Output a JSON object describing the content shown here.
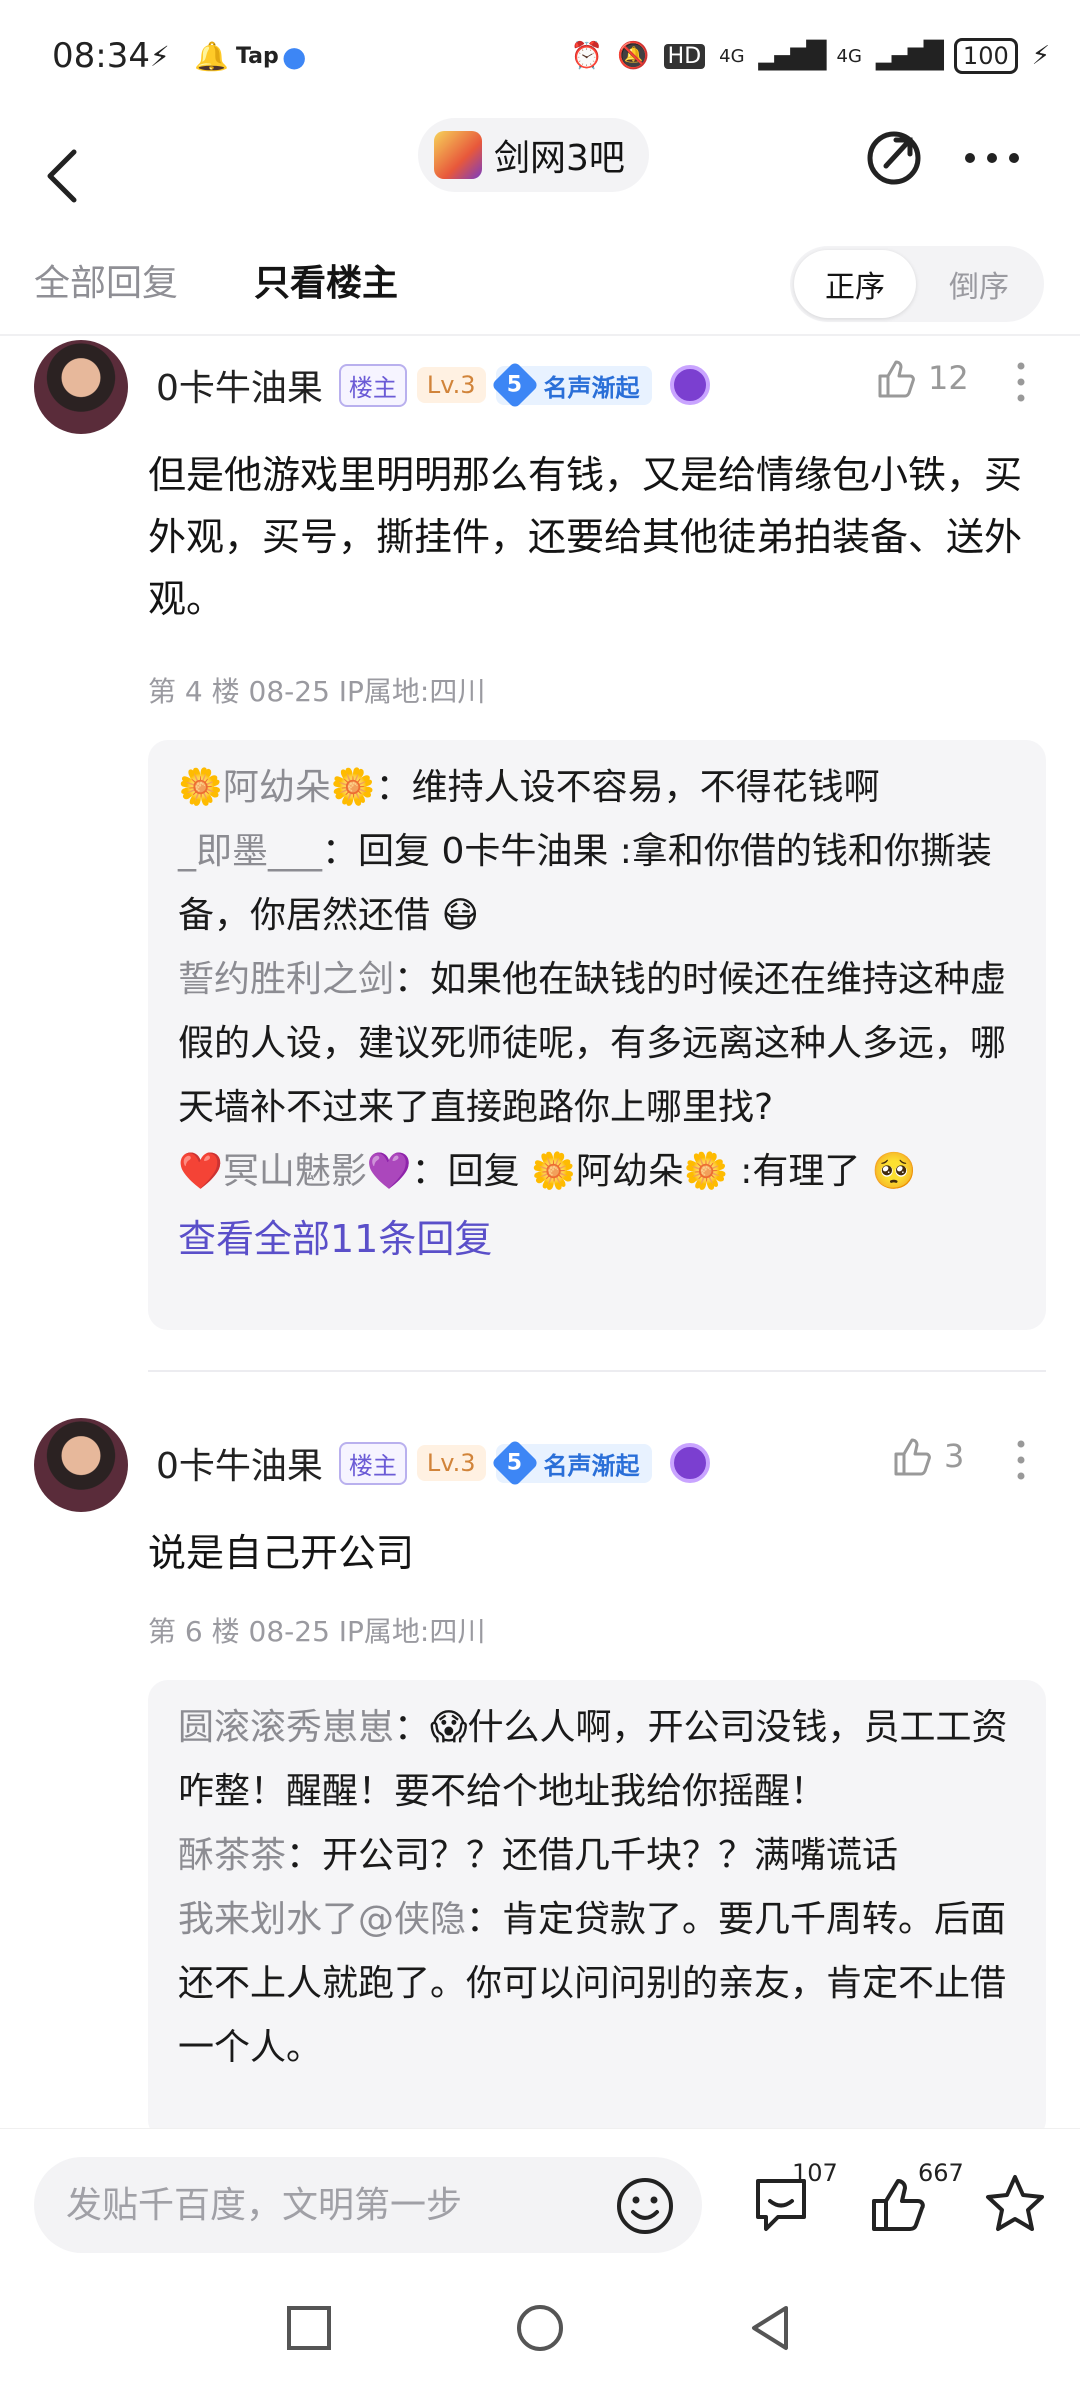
{
  "status_bar": {
    "time": "08:34",
    "network": "HD",
    "signal1": "4G",
    "signal2": "4G",
    "battery": "100"
  },
  "nav": {
    "forum_name": "剑网3吧"
  },
  "filter": {
    "tab_all": "全部回复",
    "tab_op_only": "只看楼主",
    "sort_asc": "正序",
    "sort_desc": "倒序"
  },
  "posts": [
    {
      "author": "0卡牛油果",
      "badge_op": "楼主",
      "badge_level": "Lv.3",
      "reputation_level": "5",
      "reputation_label": "名声渐起",
      "likes": "12",
      "text": "但是他游戏里明明那么有钱，又是给情缘包小铁，买外观，买号，撕挂件，还要给其他徒弟拍装备、送外观。",
      "meta": "第 4 楼  08-25  IP属地:四川",
      "replies": [
        {
          "name": "🌼阿幼朵🌼",
          "text": "：维持人设不容易，不得花钱啊"
        },
        {
          "name": "_即墨___",
          "text": "：回复 0卡牛油果 :拿和你借的钱和你撕装备，你居然还借 😷"
        },
        {
          "name": "誓约胜利之剑",
          "text": "：如果他在缺钱的时候还在维持这种虚假的人设，建议死师徒呢，有多远离这种人多远，哪天墙补不过来了直接跑路你上哪里找?"
        },
        {
          "name": "❤️冥山魅影💜",
          "text": "：回复 🌼阿幼朵🌼 :有理了 🥺"
        }
      ],
      "more_replies": "查看全部11条回复"
    },
    {
      "author": "0卡牛油果",
      "badge_op": "楼主",
      "badge_level": "Lv.3",
      "reputation_level": "5",
      "reputation_label": "名声渐起",
      "likes": "3",
      "text": "说是自己开公司",
      "meta": "第 6 楼  08-25  IP属地:四川",
      "replies": [
        {
          "name": "圆滚滚秀崽崽",
          "text": "：😱什么人啊，开公司没钱，员工工资咋整！醒醒！要不给个地址我给你摇醒！"
        },
        {
          "name": "酥茶茶",
          "text": "：开公司？？还借几千块？？满嘴谎话"
        },
        {
          "name": "我来划水了@侠隐",
          "text": "：肯定贷款了。要几千周转。后面还不上人就跑了。你可以问问别的亲友，肯定不止借一个人。"
        }
      ]
    }
  ],
  "bottom_bar": {
    "input_placeholder": "发贴千百度，文明第一步",
    "comment_count": "107",
    "like_count": "667"
  },
  "colors": {
    "accent_purple": "#5a4fc9",
    "rep_blue": "#3d86f5",
    "level_orange": "#d1843a"
  }
}
